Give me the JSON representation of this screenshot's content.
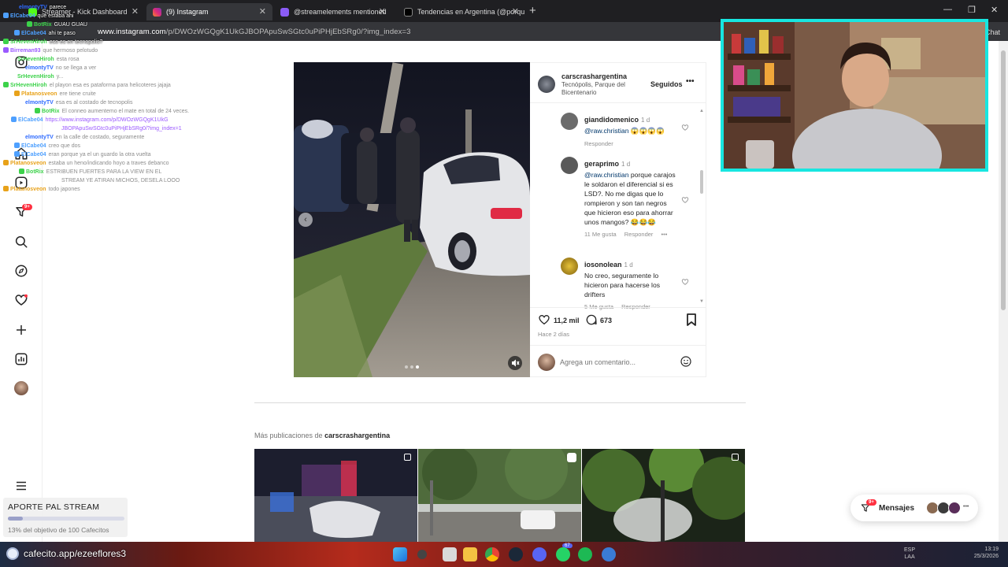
{
  "browser": {
    "tabs": [
      {
        "label": "Streamer - Kick Dashboard",
        "active": false,
        "color": "#53fc18"
      },
      {
        "label": "(9) Instagram",
        "active": true,
        "color": "#e1306c"
      },
      {
        "label": "@streamelements mentioned",
        "active": false,
        "color": "#8b5cf6"
      },
      {
        "label": "Tendencias en Argentina (@porqu",
        "active": false,
        "color": "#ffffff"
      }
    ],
    "url_host": "www.instagram.com",
    "url_path": "/p/DWOzWGQgK1UkGJBOPApuSwSGtc0uPiPHjEbSRg0/?img_index=3",
    "chat_label": "Chat"
  },
  "chat_overlay": [
    {
      "user": "elmontyTV",
      "text": "parece",
      "color": "#2f6bff",
      "faded": false
    },
    {
      "user": "ElCabe04",
      "text": "que estaba ahi",
      "color": "#4ea0ff",
      "faded": false
    },
    {
      "user": "BotRix",
      "text": "GUAU GUAU",
      "color": "#3cd24a",
      "faded": false
    },
    {
      "user": "ElCabe04",
      "text": "ahi te paso",
      "color": "#4ea0ff",
      "faded": false
    },
    {
      "user": "SrHevenHiroh",
      "text": "eso es en tecnopolis?",
      "color": "#3cd24a",
      "faded": false
    },
    {
      "user": "Birreman93",
      "text": "que hermoso pelotudo",
      "color": "#9b59ff",
      "faded": true
    },
    {
      "user": "SrHevenHiroh",
      "text": "esta rosa",
      "color": "#3cd24a",
      "faded": true
    },
    {
      "user": "elmontyTV",
      "text": "no se llega a ver",
      "color": "#2f6bff",
      "faded": true
    },
    {
      "user": "SrHevenHiroh",
      "text": "y...",
      "color": "#3cd24a",
      "faded": true
    },
    {
      "user": "SrHevenHiroh",
      "text": "el playon esa es pataforma para helicoteres jajaja",
      "color": "#3cd24a",
      "faded": true
    },
    {
      "user": "Platanosveon",
      "text": "ere tiene cruite",
      "color": "#e8a21a",
      "faded": true
    },
    {
      "user": "elmontyTV",
      "text": "esa es al costado de tecnopolis",
      "color": "#2f6bff",
      "faded": true
    },
    {
      "user": "BotRix",
      "text": "El conneo aumentemo el mate en total de 24 veces.",
      "color": "#3cd24a",
      "faded": true
    },
    {
      "user": "ElCabe04",
      "text": "https://www.instagram.com/p/DWOzWGQgK1UkG",
      "color": "#4ea0ff",
      "faded": true
    },
    {
      "user": "",
      "text": "JBOPApuSwSGtc0uPiPHjEbSRg0/?img_index=1",
      "color": "#4ea0ff",
      "faded": true
    },
    {
      "user": "elmontyTV",
      "text": "en la calle de costado, seguramente",
      "color": "#2f6bff",
      "faded": true
    },
    {
      "user": "ElCabe04",
      "text": "creo que dos",
      "color": "#4ea0ff",
      "faded": true
    },
    {
      "user": "ElCabe04",
      "text": "eran porque ya el un guardo la otra vuelta",
      "color": "#4ea0ff",
      "faded": true
    },
    {
      "user": "Platanosveon",
      "text": "estaba un heno/indicando hoyo a traves debanco",
      "color": "#e8a21a",
      "faded": true
    },
    {
      "user": "BotRix",
      "text": "ESTRIBUEN FUERTES PARA LA VIEW EN EL",
      "color": "#3cd24a",
      "faded": true
    },
    {
      "user": "",
      "text": "STREAM YE ATIRAN MICHOS, DESELA LOOO",
      "color": "#3cd24a",
      "faded": true
    },
    {
      "user": "Platanosveon",
      "text": "todo japones",
      "color": "#e8a21a",
      "faded": true
    }
  ],
  "post": {
    "username": "carscrashargentina",
    "location": "Tecnópolis, Parque del Bicentenario",
    "follow_label": "Seguidos",
    "comments": [
      {
        "user": "giandidomenico",
        "time": "1 d",
        "mention": "@raw.christian",
        "text": " 😱😱😱😱",
        "likes": "",
        "reply": "Responder"
      },
      {
        "user": "geraprimo",
        "time": "1 d",
        "mention": "@raw.christian",
        "text": " porque carajos le soldaron el diferencial si es LSD?. No me digas que lo rompieron y son tan negros que hicieron eso para ahorrar unos mangos? 😂😂😂",
        "likes": "11 Me gusta",
        "reply": "Responder"
      },
      {
        "user": "iosonolean",
        "time": "1 d",
        "mention": "",
        "text": "No creo, seguramente lo hicieron para hacerse los drifters",
        "likes": "5 Me gusta",
        "reply": "Responder"
      }
    ],
    "like_count": "11,2 mil",
    "comment_count": "673",
    "date": "Hace 2 días",
    "comment_placeholder": "Agrega un comentario..."
  },
  "more_posts": {
    "prefix": "Más publicaciones de ",
    "user": "carscrashargentina"
  },
  "messages": {
    "label": "Mensajes",
    "badge": "9+"
  },
  "nav": {
    "notif_badge": "9+"
  },
  "donation": {
    "title": "APORTE PAL STREAM",
    "progress": 0.13,
    "subtitle": "13% del objetivo de 100 Cafecitos"
  },
  "cafecito": {
    "label": "cafecito.app/ezeeflores3"
  },
  "taskbar": {
    "lang_top": "ESP",
    "lang_bottom": "LAA",
    "time": "13:19",
    "date": "25/3/2026",
    "discord_badge": "67"
  }
}
